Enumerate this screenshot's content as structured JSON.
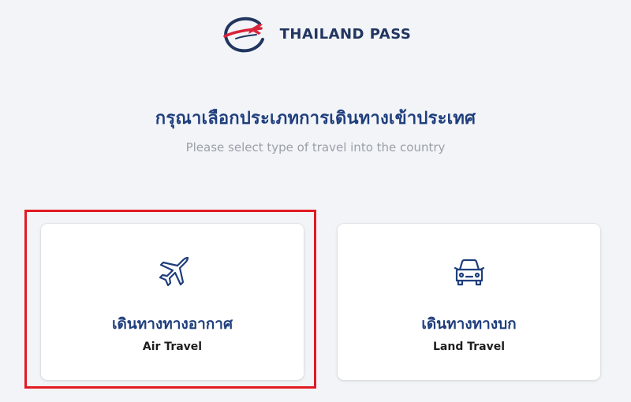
{
  "brand": {
    "name": "THAILAND PASS",
    "colors": {
      "navy": "#21355f",
      "red": "#d9243a",
      "highlight": "#e21a22"
    }
  },
  "header": {
    "title_th": "กรุณาเลือกประเภทการเดินทางเข้าประเทศ",
    "subtitle_en": "Please select type of travel into the country"
  },
  "options": [
    {
      "id": "air",
      "label_th": "เดินทางทางอากาศ",
      "label_en": "Air Travel",
      "icon": "airplane-icon",
      "highlighted": true
    },
    {
      "id": "land",
      "label_th": "เดินทางทางบก",
      "label_en": "Land Travel",
      "icon": "car-icon",
      "highlighted": false
    }
  ]
}
